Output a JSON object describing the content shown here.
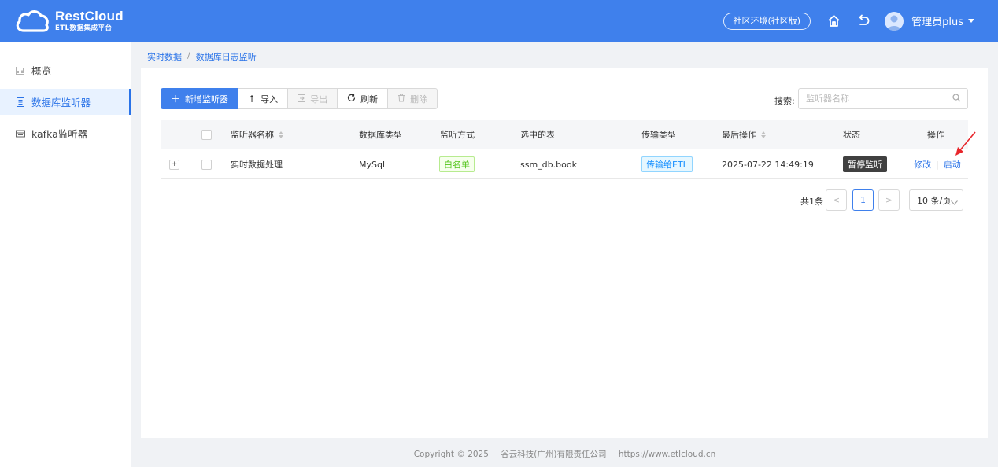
{
  "header": {
    "logo_name": "RestCloud",
    "logo_sub": "ETL数据集成平台",
    "env_badge": "社区环境(社区版)",
    "user_name": "管理员plus",
    "color": "#3f80ec"
  },
  "sidebar": {
    "items": [
      {
        "label": "概览",
        "icon": "chart-icon",
        "active": false
      },
      {
        "label": "数据库监听器",
        "icon": "list-icon",
        "active": true
      },
      {
        "label": "kafka监听器",
        "icon": "stack-icon",
        "active": false
      }
    ]
  },
  "breadcrumb": {
    "items": [
      "实时数据",
      "数据库日志监听"
    ],
    "separator": "/"
  },
  "toolbar": {
    "new_label": "新增监听器",
    "import_label": "导入",
    "export_label": "导出",
    "refresh_label": "刷新",
    "delete_label": "删除"
  },
  "search": {
    "label": "搜索:",
    "placeholder": "监听器名称"
  },
  "table": {
    "columns": [
      "",
      "",
      "监听器名称",
      "数据库类型",
      "监听方式",
      "选中的表",
      "传输类型",
      "最后操作",
      "状态",
      "操作"
    ],
    "rows": [
      {
        "expand": "+",
        "name": "实时数据处理",
        "db_type": "MySql",
        "listen_mode": "白名单",
        "tables": "ssm_db.book",
        "transfer_type": "传输给ETL",
        "last_op": "2025-07-22 14:49:19",
        "status": "暂停监听",
        "action_edit": "修改",
        "action_start": "启动"
      }
    ]
  },
  "pagination": {
    "total": "共1条",
    "prev": "<",
    "current": "1",
    "next": ">",
    "page_size": "10 条/页"
  },
  "footer": {
    "copyright": "Copyright © 2025",
    "company": "谷云科技(广州)有限责任公司",
    "url": "https://www.etlcloud.cn"
  }
}
